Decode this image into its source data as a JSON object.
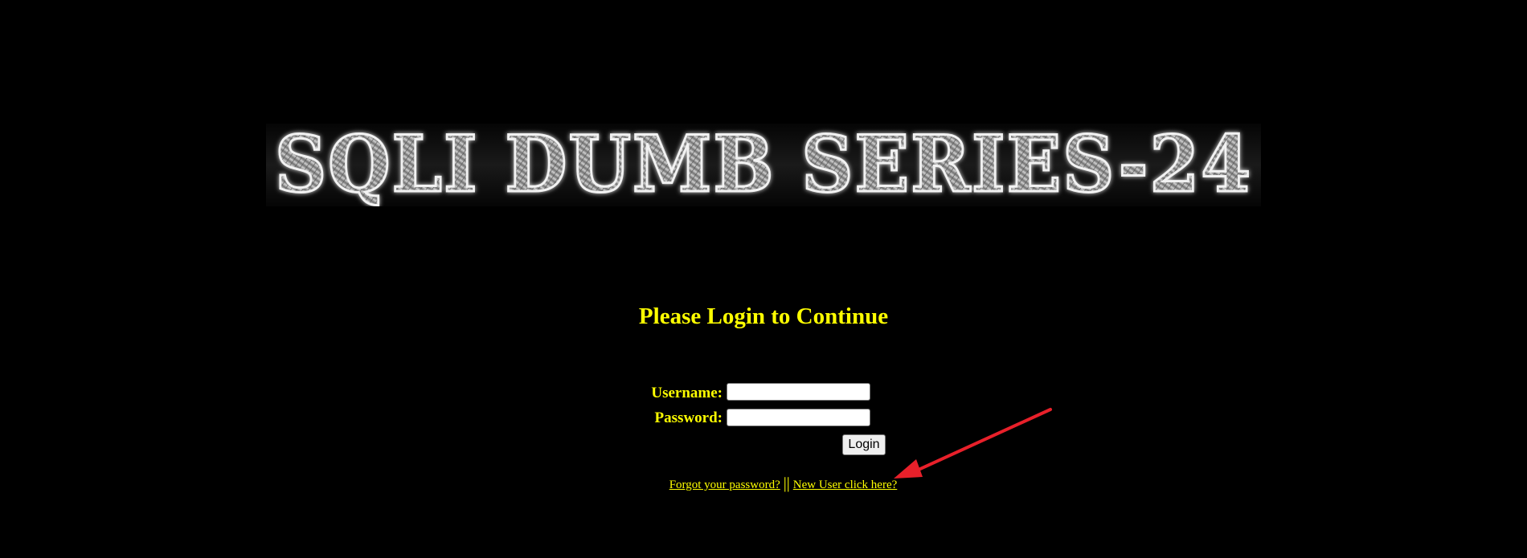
{
  "banner": {
    "text": "SQLI DUMB SERIES-24"
  },
  "heading": "Please Login to Continue",
  "form": {
    "username_label": "Username:",
    "username_value": "",
    "password_label": "Password:",
    "password_value": "",
    "login_button": "Login"
  },
  "links": {
    "forgot_password": "Forgot your password?",
    "separator": "||",
    "new_user": "New User click here?"
  },
  "colors": {
    "background": "#000000",
    "text": "#ffff00",
    "annotation_arrow": "#e8202a"
  },
  "icons": {
    "annotation": "red-arrow-icon"
  }
}
